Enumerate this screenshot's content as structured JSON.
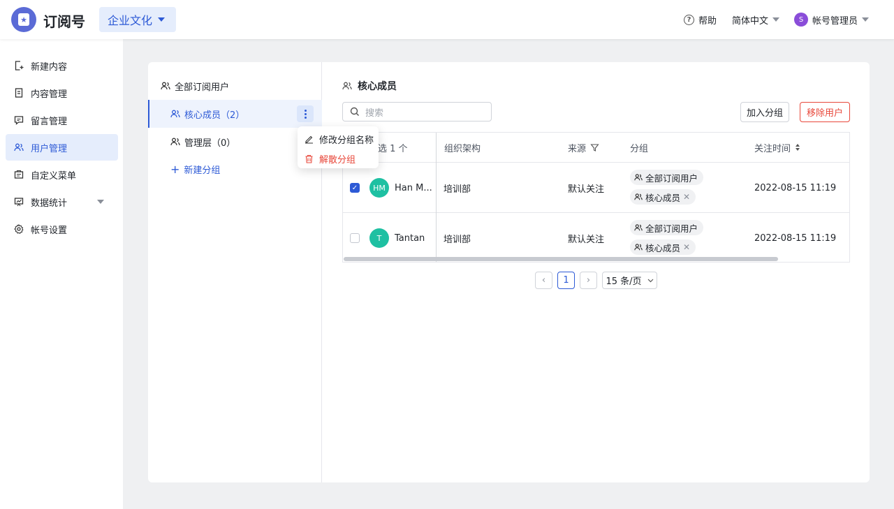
{
  "header": {
    "app_title": "订阅号",
    "account": "企业文化",
    "help": "帮助",
    "language": "简体中文",
    "user_initial": "S",
    "user_name": "帐号管理员"
  },
  "sidebar": {
    "items": [
      {
        "label": "新建内容",
        "icon": "new-content-icon"
      },
      {
        "label": "内容管理",
        "icon": "document-icon"
      },
      {
        "label": "留言管理",
        "icon": "comment-icon"
      },
      {
        "label": "用户管理",
        "icon": "users-icon",
        "active": true
      },
      {
        "label": "自定义菜单",
        "icon": "menu-icon"
      },
      {
        "label": "数据统计",
        "icon": "chart-icon"
      },
      {
        "label": "帐号设置",
        "icon": "gear-icon"
      }
    ]
  },
  "groups": {
    "all": "全部订阅用户",
    "items": [
      {
        "label": "核心成员（2）",
        "active": true
      },
      {
        "label": "管理层（0）"
      }
    ],
    "new_group": "新建分组"
  },
  "dropdown": {
    "rename": "修改分组名称",
    "dissolve": "解散分组"
  },
  "panel": {
    "title": "核心成员",
    "search_placeholder": "搜索",
    "add_to_group": "加入分组",
    "remove_user": "移除用户"
  },
  "table": {
    "headers": {
      "selected": "选 1 个",
      "org": "组织架构",
      "source": "来源",
      "group": "分组",
      "follow_time": "关注时间"
    },
    "rows": [
      {
        "initials": "HM",
        "name": "Han M...",
        "org": "培训部",
        "source": "默认关注",
        "tag1": "全部订阅用户",
        "tag2": "核心成员",
        "time": "2022-08-15 11:19",
        "checked": true
      },
      {
        "initials": "T",
        "name": "Tantan",
        "org": "培训部",
        "source": "默认关注",
        "tag1": "全部订阅用户",
        "tag2": "核心成员",
        "time": "2022-08-15 11:19",
        "checked": false
      }
    ]
  },
  "pagination": {
    "current": "1",
    "page_size": "15 条/页"
  },
  "colors": {
    "primary": "#2d5ad6",
    "danger": "#e8473a",
    "avatar": "#1ec0a2"
  }
}
